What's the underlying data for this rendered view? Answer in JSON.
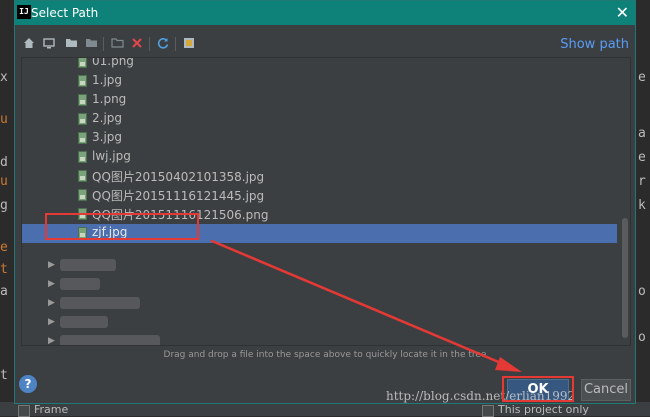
{
  "dialog": {
    "title": "Select Path",
    "icon_text": "IJ",
    "close_glyph": "✕",
    "show_path_label": "Show path",
    "hint": "Drag and drop a file into the space above to quickly locate it in the tree",
    "ok_label": "OK",
    "cancel_label": "Cancel",
    "help_glyph": "?"
  },
  "toolbar": {
    "icons": [
      "home-icon",
      "desktop-icon",
      "project-folder-icon",
      "module-folder-icon",
      "new-folder-icon",
      "delete-icon",
      "refresh-icon",
      "show-hidden-icon"
    ]
  },
  "files": [
    {
      "name": "01.png"
    },
    {
      "name": "1.jpg"
    },
    {
      "name": "1.png"
    },
    {
      "name": "2.jpg"
    },
    {
      "name": "3.jpg"
    },
    {
      "name": "lwj.jpg"
    },
    {
      "name": "QQ图片20150402101358.jpg"
    },
    {
      "name": "QQ图片20151116121445.jpg"
    },
    {
      "name": "QQ图片20151116121506.png"
    },
    {
      "name": "zjf.jpg",
      "selected": true
    }
  ],
  "background": {
    "bottom_left_label": "Frame",
    "bottom_right_label": "This project only"
  },
  "watermark": "http://blog.csdn.net/erlian1992",
  "colors": {
    "titlebar": "#0e8278",
    "selection": "#4b6eaf",
    "link": "#589df6",
    "annotation": "#e53935"
  }
}
